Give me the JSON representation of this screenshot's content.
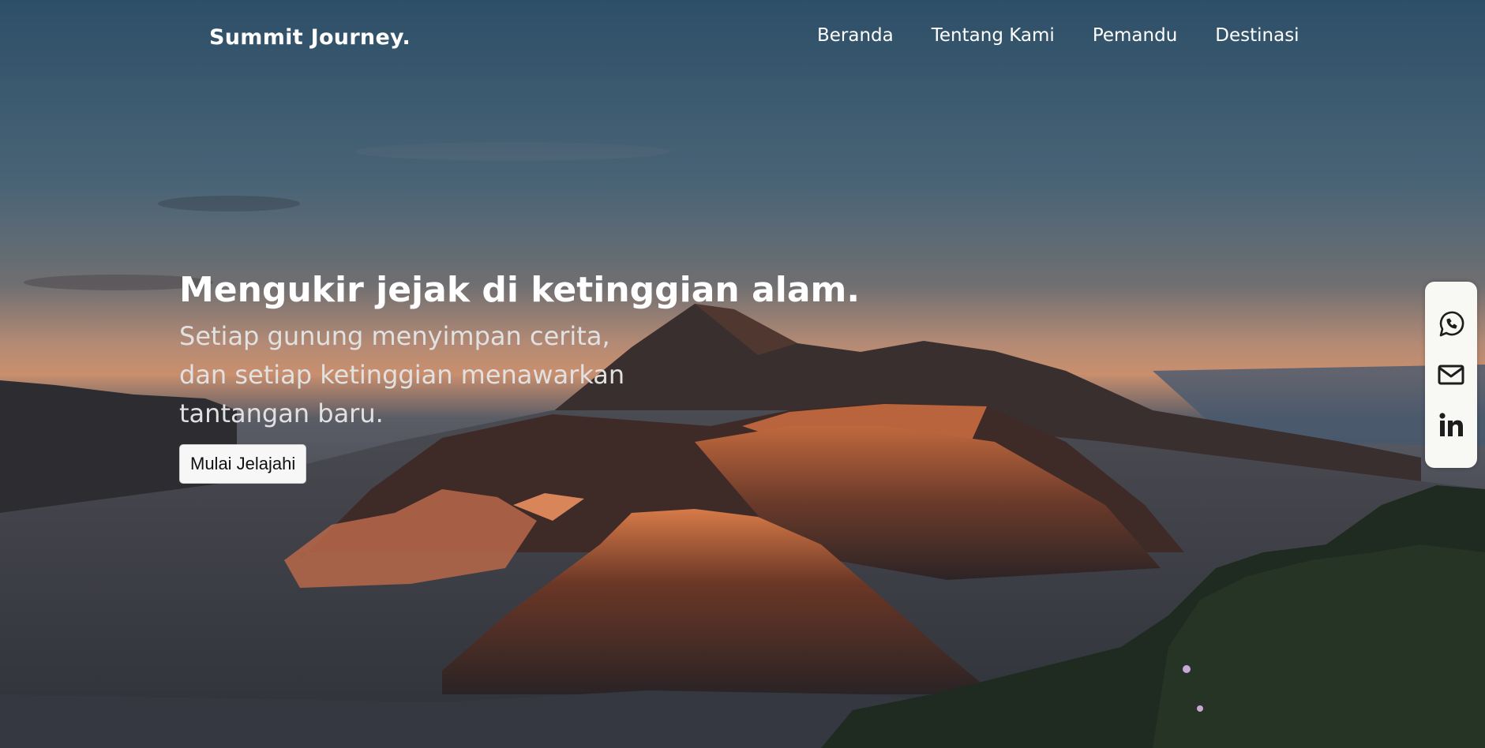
{
  "navbar": {
    "brand": "Summit Journey.",
    "links": [
      "Beranda",
      "Tentang Kami",
      "Pemandu",
      "Destinasi"
    ]
  },
  "hero": {
    "title": "Mengukir jejak di ketinggian alam.",
    "subtitle_lines": [
      "Setiap gunung menyimpan cerita,",
      "dan setiap ketinggian menawarkan",
      "tantangan baru."
    ],
    "cta_label": "Mulai Jelajahi"
  },
  "social": {
    "icons": [
      "whatsapp-icon",
      "mail-icon",
      "linkedin-icon"
    ]
  },
  "colors": {
    "sky_top": "#2d4f68",
    "sky_horizon": "#c98f6e",
    "sidebar_bg": "#f8f8f4",
    "button_bg": "#f7f7f7",
    "text_white": "#ffffff"
  }
}
